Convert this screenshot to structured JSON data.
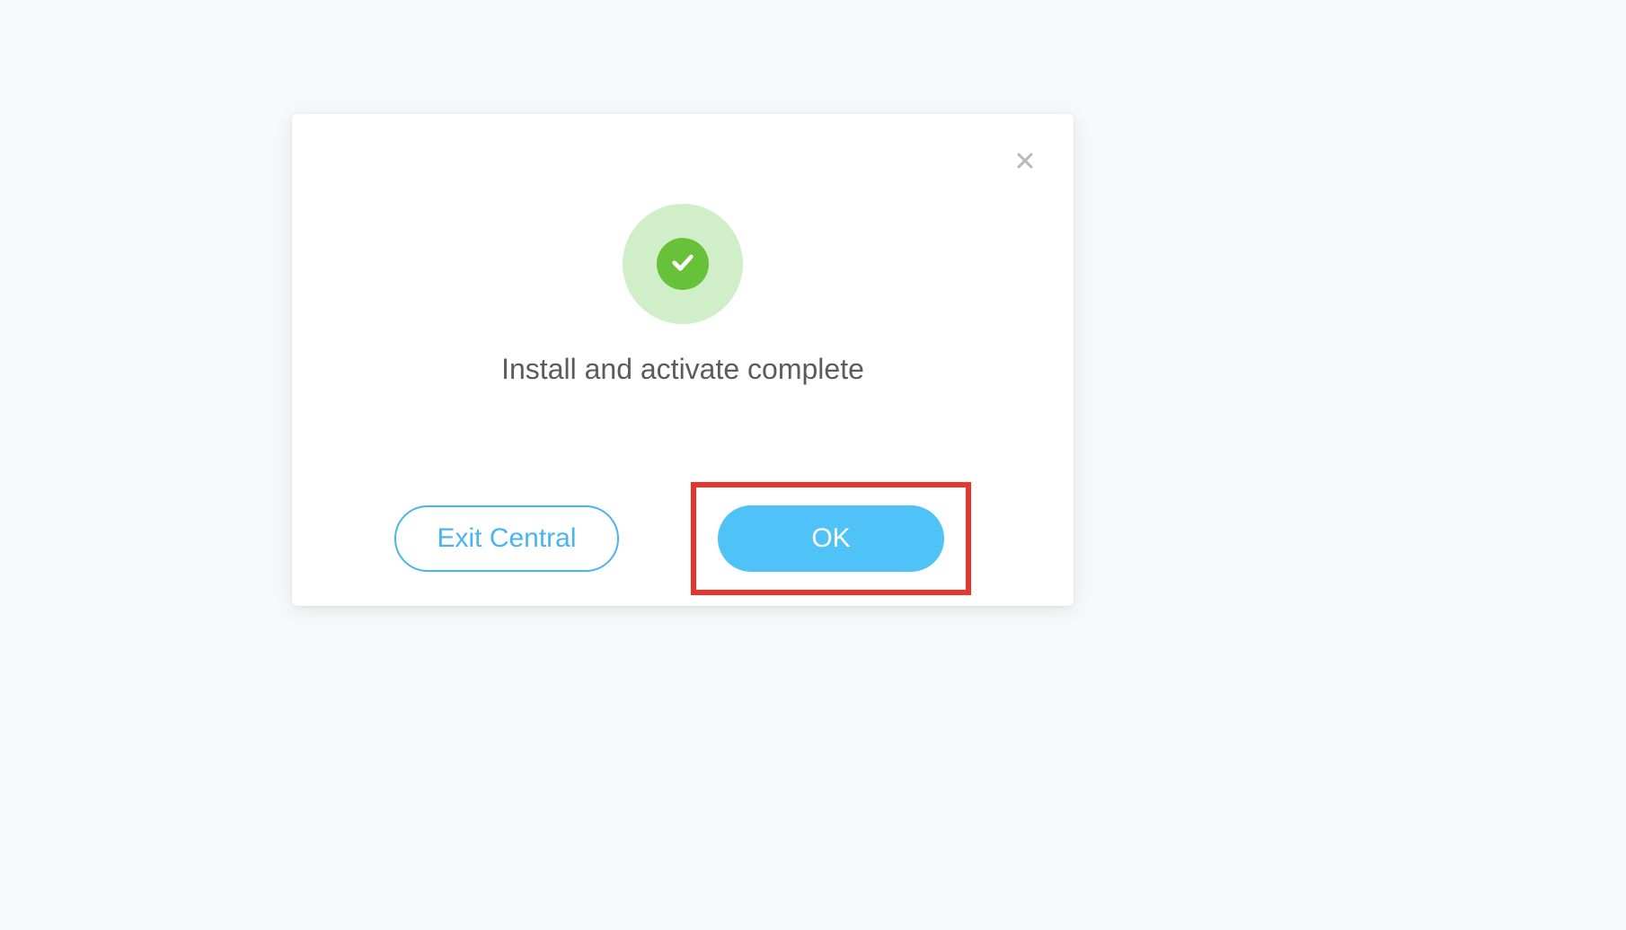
{
  "dialog": {
    "message": "Install and activate complete",
    "buttons": {
      "secondary_label": "Exit Central",
      "primary_label": "OK"
    }
  },
  "colors": {
    "accent": "#4fc2f8",
    "success": "#67c23a",
    "highlight_border": "#e8362d"
  }
}
